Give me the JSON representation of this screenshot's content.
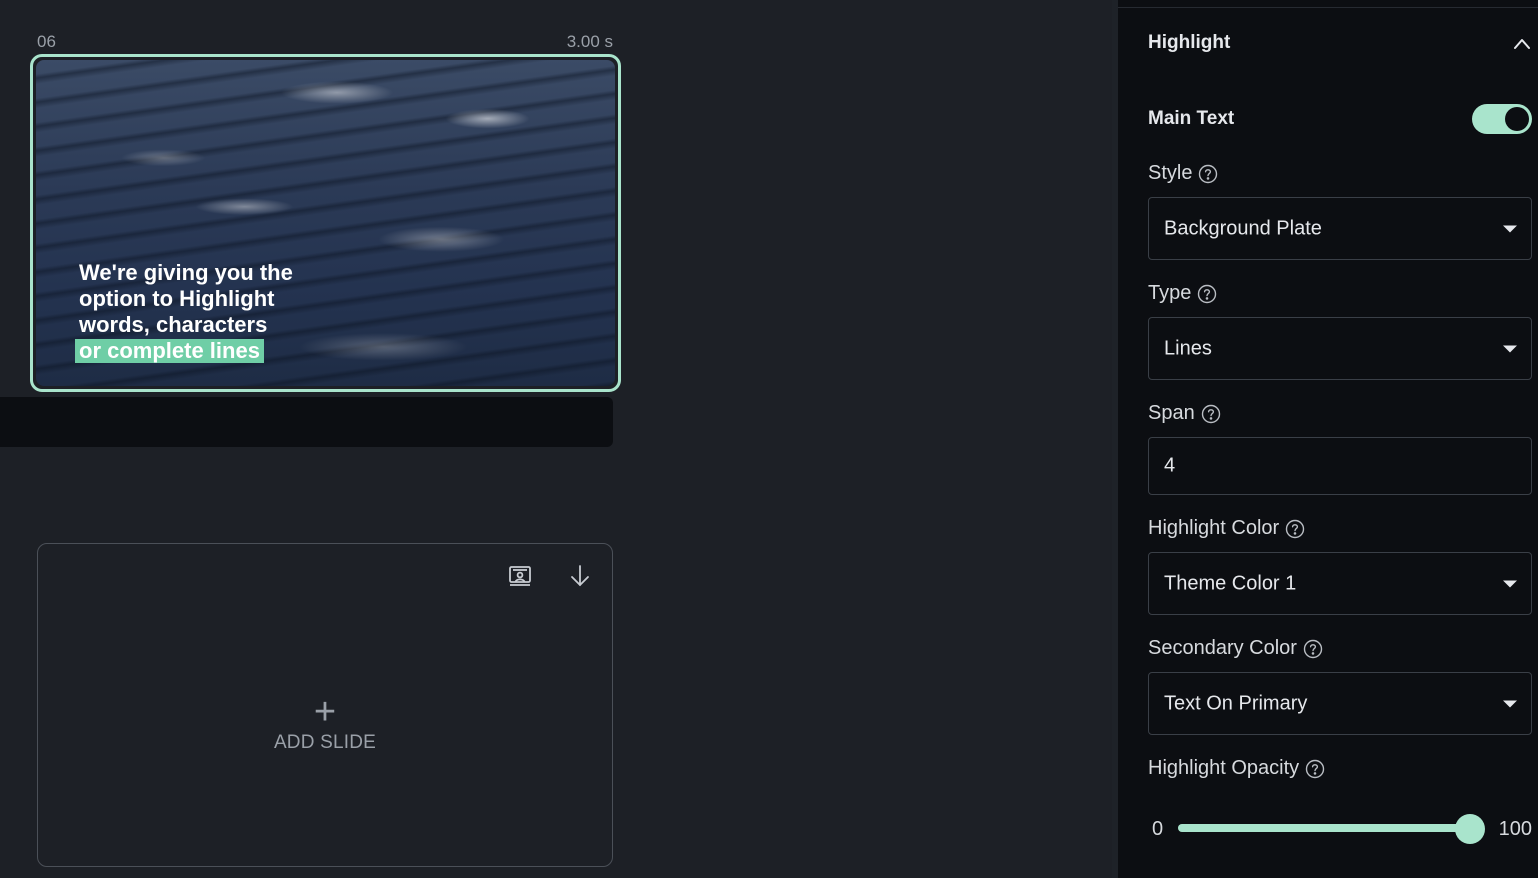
{
  "slide": {
    "number": "06",
    "duration": "3.00 s",
    "caption_lines": [
      "We're giving you the",
      "option to Highlight",
      "words, characters"
    ],
    "caption_highlight": "or complete lines"
  },
  "add_slide": {
    "label": "ADD SLIDE",
    "icons": [
      "slideshow-icon",
      "arrow-down-icon"
    ]
  },
  "panel": {
    "section_title": "Highlight",
    "main_text": {
      "label": "Main Text",
      "enabled": true
    },
    "style": {
      "label": "Style",
      "value": "Background Plate"
    },
    "type": {
      "label": "Type",
      "value": "Lines"
    },
    "span": {
      "label": "Span",
      "value": "4"
    },
    "highlight_color": {
      "label": "Highlight Color",
      "value": "Theme Color 1"
    },
    "secondary_color": {
      "label": "Secondary Color",
      "value": "Text On Primary"
    },
    "highlight_opacity": {
      "label": "Highlight Opacity",
      "min": "0",
      "max": "100",
      "value": 100
    }
  },
  "colors": {
    "accent": "#a9e4cc",
    "highlight_plate": "#6fcea6",
    "panel_bg": "#0c0e12",
    "canvas_bg": "#1d2026"
  }
}
